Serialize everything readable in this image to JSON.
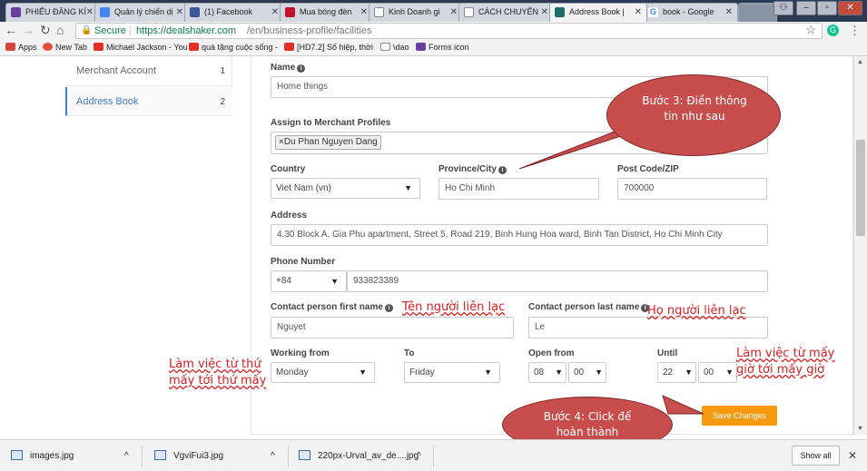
{
  "tabs": [
    {
      "title": "PHIẾU ĐĂNG KÍ",
      "icon": "forms-icon",
      "color": "#6b3fa0"
    },
    {
      "title": "Quản lý chiến dị",
      "icon": "google-ads-icon",
      "color": "#4285f4"
    },
    {
      "title": "(1) Facebook",
      "icon": "facebook-icon",
      "color": "#3b5998"
    },
    {
      "title": "Mua bóng đèn",
      "icon": "shop-icon",
      "color": "#c8102e"
    },
    {
      "title": "Kinh Doanh gi",
      "icon": "page-icon",
      "color": "#888888"
    },
    {
      "title": "CÁCH CHUYỂN",
      "icon": "page-icon",
      "color": "#888888"
    },
    {
      "title": "Address Book |",
      "icon": "dealshaker-icon",
      "color": "#1d6e6a",
      "active": true
    },
    {
      "title": "book - Google",
      "icon": "google-icon",
      "color": "#4285f4"
    }
  ],
  "address_bar": {
    "secure_label": "Secure",
    "url_host": "https://dealshaker.com",
    "url_path": "/en/business-profile/facilities"
  },
  "bookmarks": [
    {
      "label": "Apps",
      "icon": "apps-icon",
      "color": "#d44638"
    },
    {
      "label": "New Tab",
      "icon": "new-tab-icon",
      "color": "#e84c3d"
    },
    {
      "label": "Michael Jackson - You",
      "icon": "youtube-icon",
      "color": "#e52d27"
    },
    {
      "label": "quà tặng cuộc sống -",
      "icon": "youtube-icon",
      "color": "#e52d27"
    },
    {
      "label": "[HD7.2] Số hiệp, thời",
      "icon": "youtube-icon",
      "color": "#e52d27"
    },
    {
      "label": "\\dao",
      "icon": "page-icon",
      "color": "#888888"
    },
    {
      "label": "Forms icon",
      "icon": "forms-icon",
      "color": "#6b3fa0"
    }
  ],
  "sidebar": {
    "items": [
      {
        "label": "Merchant Account",
        "count": "1"
      },
      {
        "label": "Address Book",
        "count": "2",
        "active": true
      }
    ]
  },
  "form": {
    "name_label": "Name",
    "name_value": "Home things",
    "assign_label": "Assign to Merchant Profiles",
    "assign_tag": "Du Phan Nguyen Dang",
    "country_label": "Country",
    "country_value": "Viet Nam (vn)",
    "province_label": "Province/City",
    "province_value": "Ho Chi Minh",
    "postcode_label": "Post Code/ZIP",
    "postcode_value": "700000",
    "address_label": "Address",
    "address_value": "4.30 Block A, Gia Phu apartment, Street 5, Road 219, Binh Hung Hoa ward, Binh Tan District, Ho Chi Minh City",
    "phone_label": "Phone Number",
    "phone_code": "+84",
    "phone_value": "933823389",
    "first_name_label": "Contact person first name",
    "first_name_value": "Nguyet",
    "last_name_label": "Contact person last name",
    "last_name_value": "Le",
    "working_from_label": "Working from",
    "working_from_value": "Monday",
    "to_label": "To",
    "to_value": "Friday",
    "open_from_label": "Open from",
    "open_hour": "08",
    "open_min": "00",
    "until_label": "Until",
    "until_hour": "22",
    "until_min": "00",
    "save_label": "Save Changes"
  },
  "annotations": {
    "step3": "Bước 3: Điền thông tin như sau",
    "step4": "Bước 4: Click để hoàn thành",
    "first_name_note": "Tên người liên lạc",
    "last_name_note": "Họ người liên lạc",
    "working_days_note_1": "Làm việc từ thứ",
    "working_days_note_2": "mấy tới thứ mấy",
    "hours_note_1": "Làm việc từ mấy",
    "hours_note_2": "giờ tới mấy giờ"
  },
  "downloads": {
    "items": [
      {
        "label": "images.jpg"
      },
      {
        "label": "VgviFui3.jpg"
      },
      {
        "label": "220px-Urval_av_de....jpg"
      }
    ],
    "show_all_label": "Show all"
  },
  "colors": {
    "accent_orange": "#f79a10",
    "link_blue": "#3d7dca",
    "callout_red": "#c84e4e",
    "annotation_red": "#d82020",
    "secure_green": "#0b8043"
  }
}
